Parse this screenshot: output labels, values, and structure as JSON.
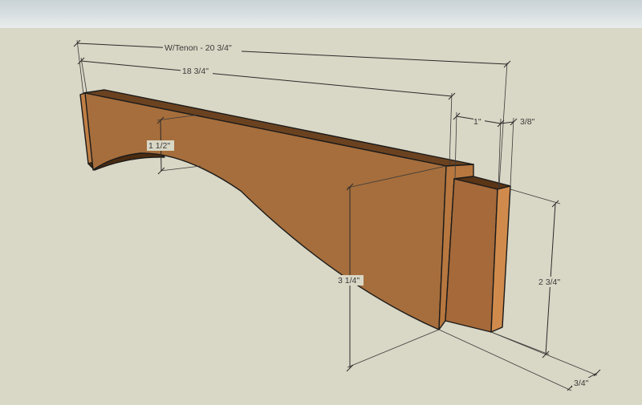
{
  "colors": {
    "sky_top": "#c9d2d6",
    "sky_bottom": "#e6eaea",
    "ground": "#d9d7c5",
    "wood_face": "#a66e3c",
    "wood_top": "#6b4220",
    "wood_end": "#c98a4e",
    "wood_dark": "#3e2410",
    "dimension_line": "#2a2a2a"
  },
  "dimensions": {
    "overall_with_tenon": "W/Tenon - 20 3/4\"",
    "body_length": "18 3/4\"",
    "arch_rise": "1 1/2\"",
    "tenon_length": "1\"",
    "tenon_thickness": "3/8\"",
    "end_height": "3 1/4\"",
    "tenon_height": "2 3/4\"",
    "stock_thickness": "3/4\""
  }
}
